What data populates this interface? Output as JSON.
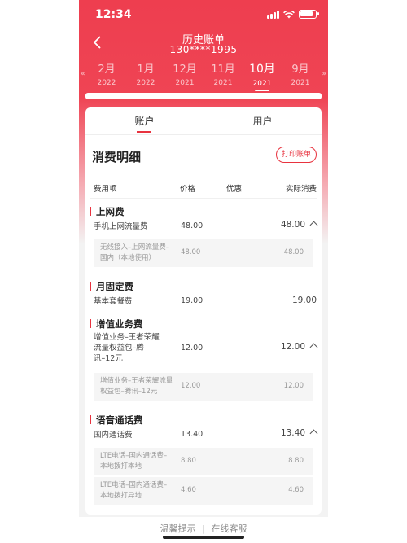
{
  "status": {
    "time": "12:34"
  },
  "nav": {
    "title": "历史账单",
    "subtitle": "130****1995"
  },
  "months": [
    {
      "m": "2月",
      "y": "2022"
    },
    {
      "m": "1月",
      "y": "2022"
    },
    {
      "m": "12月",
      "y": "2021"
    },
    {
      "m": "11月",
      "y": "2021"
    },
    {
      "m": "10月",
      "y": "2021",
      "active": true
    },
    {
      "m": "9月",
      "y": "2021"
    }
  ],
  "arrows": {
    "left": "«",
    "right": "»"
  },
  "tabs": {
    "account": "账户",
    "user": "用户"
  },
  "section": {
    "title": "消费明细",
    "print": "打印账单"
  },
  "columns": {
    "item": "费用项",
    "price": "价格",
    "discount": "优惠",
    "actual": "实际消费"
  },
  "categories": [
    {
      "title": "上网费",
      "rows": [
        {
          "name": "手机上网流量费",
          "price": "48.00",
          "actual": "48.00",
          "expanded": true
        }
      ],
      "subs": [
        {
          "name": "无线接入–上网流量费–\n国内（本地使用）",
          "price": "48.00",
          "actual": "48.00"
        }
      ]
    },
    {
      "title": "月固定费",
      "rows": [
        {
          "name": "基本套餐费",
          "price": "19.00",
          "actual": "19.00"
        }
      ],
      "subs": []
    },
    {
      "title": "增值业务费",
      "rows": [
        {
          "name": "增值业务–王者荣耀\n流量权益包–腾\n讯–12元",
          "price": "12.00",
          "actual": "12.00",
          "expanded": true
        }
      ],
      "subs": [
        {
          "name": "增值业务–王者荣耀流量\n权益包–腾讯–12元",
          "price": "12.00",
          "actual": "12.00"
        }
      ]
    },
    {
      "title": "语音通话费",
      "rows": [
        {
          "name": "国内通话费",
          "price": "13.40",
          "actual": "13.40",
          "expanded": true
        }
      ],
      "subs": [
        {
          "name": "LTE电话–国内通话费–\n本地拨打本地",
          "price": "8.80",
          "actual": "8.80"
        },
        {
          "name": "LTE电话–国内通话费–\n本地拨打异地",
          "price": "4.60",
          "actual": "4.60"
        }
      ]
    }
  ],
  "footer": {
    "tips": "温馨提示",
    "sep": "|",
    "service": "在线客服"
  },
  "colors": {
    "accent": "#e8333f",
    "header": "#ee3e4f"
  }
}
